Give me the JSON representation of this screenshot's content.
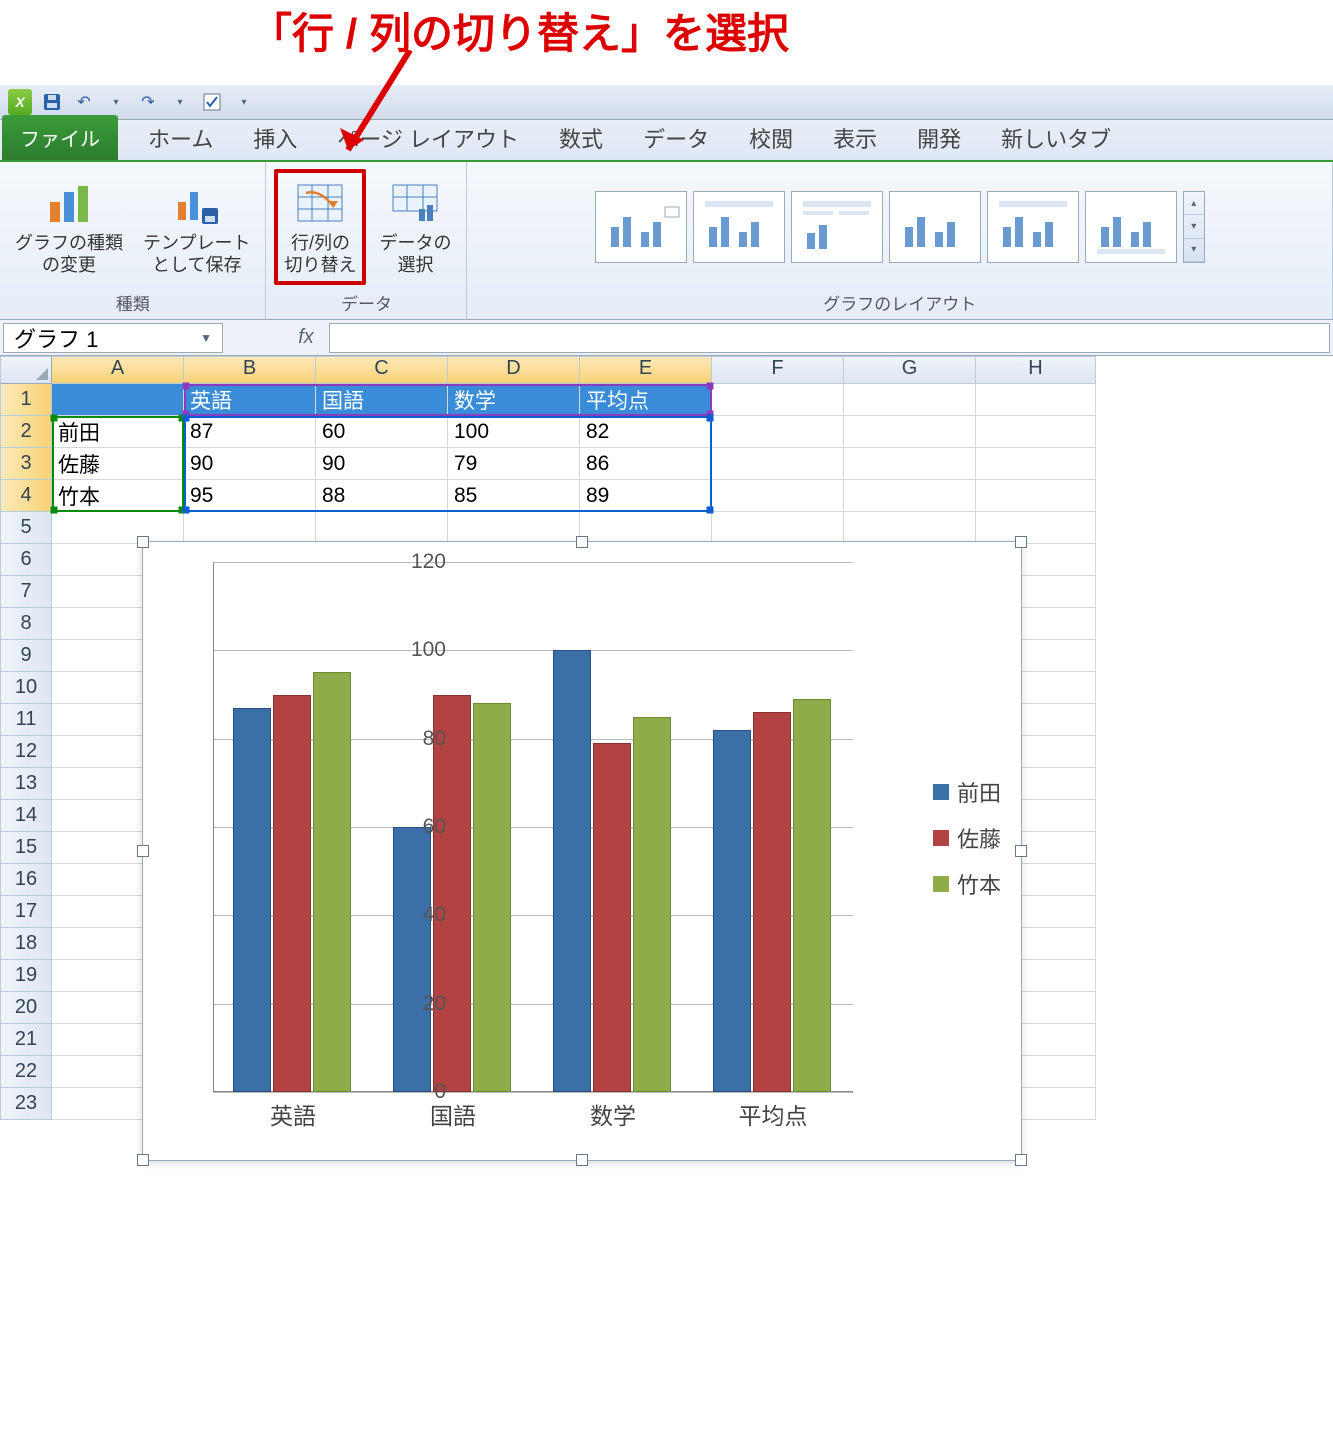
{
  "annotation": {
    "text": "「行 / 列の切り替え」を選択"
  },
  "qat": {
    "undo_tooltip": "元に戻す",
    "redo_tooltip": "やり直し",
    "save_tooltip": "上書き保存"
  },
  "tabs": {
    "file": "ファイル",
    "home": "ホーム",
    "insert": "挿入",
    "page_layout": "ページ レイアウト",
    "formulas": "数式",
    "data": "データ",
    "review": "校閲",
    "view": "表示",
    "developer": "開発",
    "new_tab": "新しいタブ"
  },
  "ribbon": {
    "group_type": "種類",
    "group_data": "データ",
    "group_layout": "グラフのレイアウト",
    "change_chart_type": "グラフの種類\nの変更",
    "save_template": "テンプレート\nとして保存",
    "switch_row_col": "行/列の\n切り替え",
    "select_data": "データの\n選択"
  },
  "namebox": {
    "value": "グラフ 1"
  },
  "formula_bar": {
    "fx": "fx"
  },
  "columns": [
    "A",
    "B",
    "C",
    "D",
    "E",
    "F",
    "G",
    "H"
  ],
  "rows": [
    1,
    2,
    3,
    4,
    5,
    6,
    7,
    8,
    9,
    10,
    11,
    12,
    13,
    14,
    15,
    16,
    17,
    18,
    19,
    20,
    21,
    22,
    23
  ],
  "table": {
    "headers": [
      "",
      "英語",
      "国語",
      "数学",
      "平均点"
    ],
    "rows": [
      {
        "name": "前田",
        "values": [
          87,
          60,
          100,
          82
        ]
      },
      {
        "name": "佐藤",
        "values": [
          90,
          90,
          79,
          86
        ]
      },
      {
        "name": "竹本",
        "values": [
          95,
          88,
          85,
          89
        ]
      }
    ]
  },
  "chart_data": {
    "type": "bar",
    "categories": [
      "英語",
      "国語",
      "数学",
      "平均点"
    ],
    "series": [
      {
        "name": "前田",
        "values": [
          87,
          60,
          100,
          82
        ],
        "color": "#3b6fa8"
      },
      {
        "name": "佐藤",
        "values": [
          90,
          90,
          79,
          86
        ],
        "color": "#b34343"
      },
      {
        "name": "竹本",
        "values": [
          95,
          88,
          85,
          89
        ],
        "color": "#8fac4a"
      }
    ],
    "ylim": [
      0,
      120
    ],
    "yticks": [
      0,
      20,
      40,
      60,
      80,
      100,
      120
    ],
    "title": "",
    "xlabel": "",
    "ylabel": ""
  }
}
